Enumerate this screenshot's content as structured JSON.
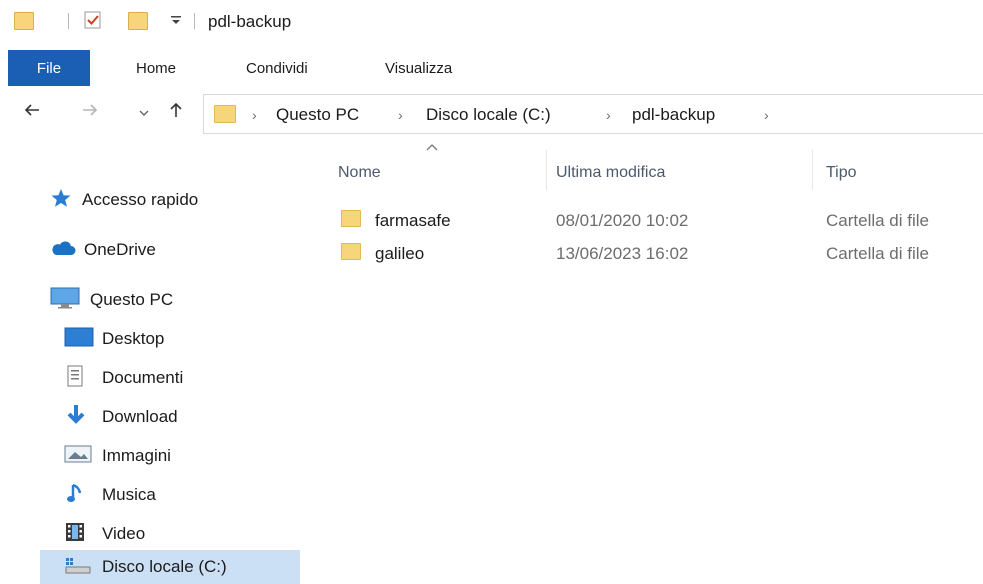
{
  "window": {
    "title": "pdl-backup"
  },
  "ribbon": {
    "file_label": "File",
    "tabs": [
      "Home",
      "Condividi",
      "Visualizza"
    ]
  },
  "address": {
    "breadcrumbs": [
      "Questo PC",
      "Disco locale (C:)",
      "pdl-backup"
    ]
  },
  "sidebar": {
    "quick_access": "Accesso rapido",
    "onedrive": "OneDrive",
    "this_pc": "Questo PC",
    "items": [
      {
        "label": "Desktop",
        "icon": "desktop-icon"
      },
      {
        "label": "Documenti",
        "icon": "documents-icon"
      },
      {
        "label": "Download",
        "icon": "download-icon"
      },
      {
        "label": "Immagini",
        "icon": "pictures-icon"
      },
      {
        "label": "Musica",
        "icon": "music-icon"
      },
      {
        "label": "Video",
        "icon": "video-icon"
      },
      {
        "label": "Disco locale (C:)",
        "icon": "drive-icon",
        "selected": true
      }
    ]
  },
  "file_list": {
    "columns": [
      "Nome",
      "Ultima modifica",
      "Tipo"
    ],
    "rows": [
      {
        "name": "farmasafe",
        "modified": "08/01/2020 10:02",
        "type": "Cartella di file"
      },
      {
        "name": "galileo",
        "modified": "13/06/2023 16:02",
        "type": "Cartella di file"
      }
    ]
  },
  "colors": {
    "accent": "#1a5fb4",
    "selection": "#cce0f5",
    "folder": "#f7d57a"
  }
}
